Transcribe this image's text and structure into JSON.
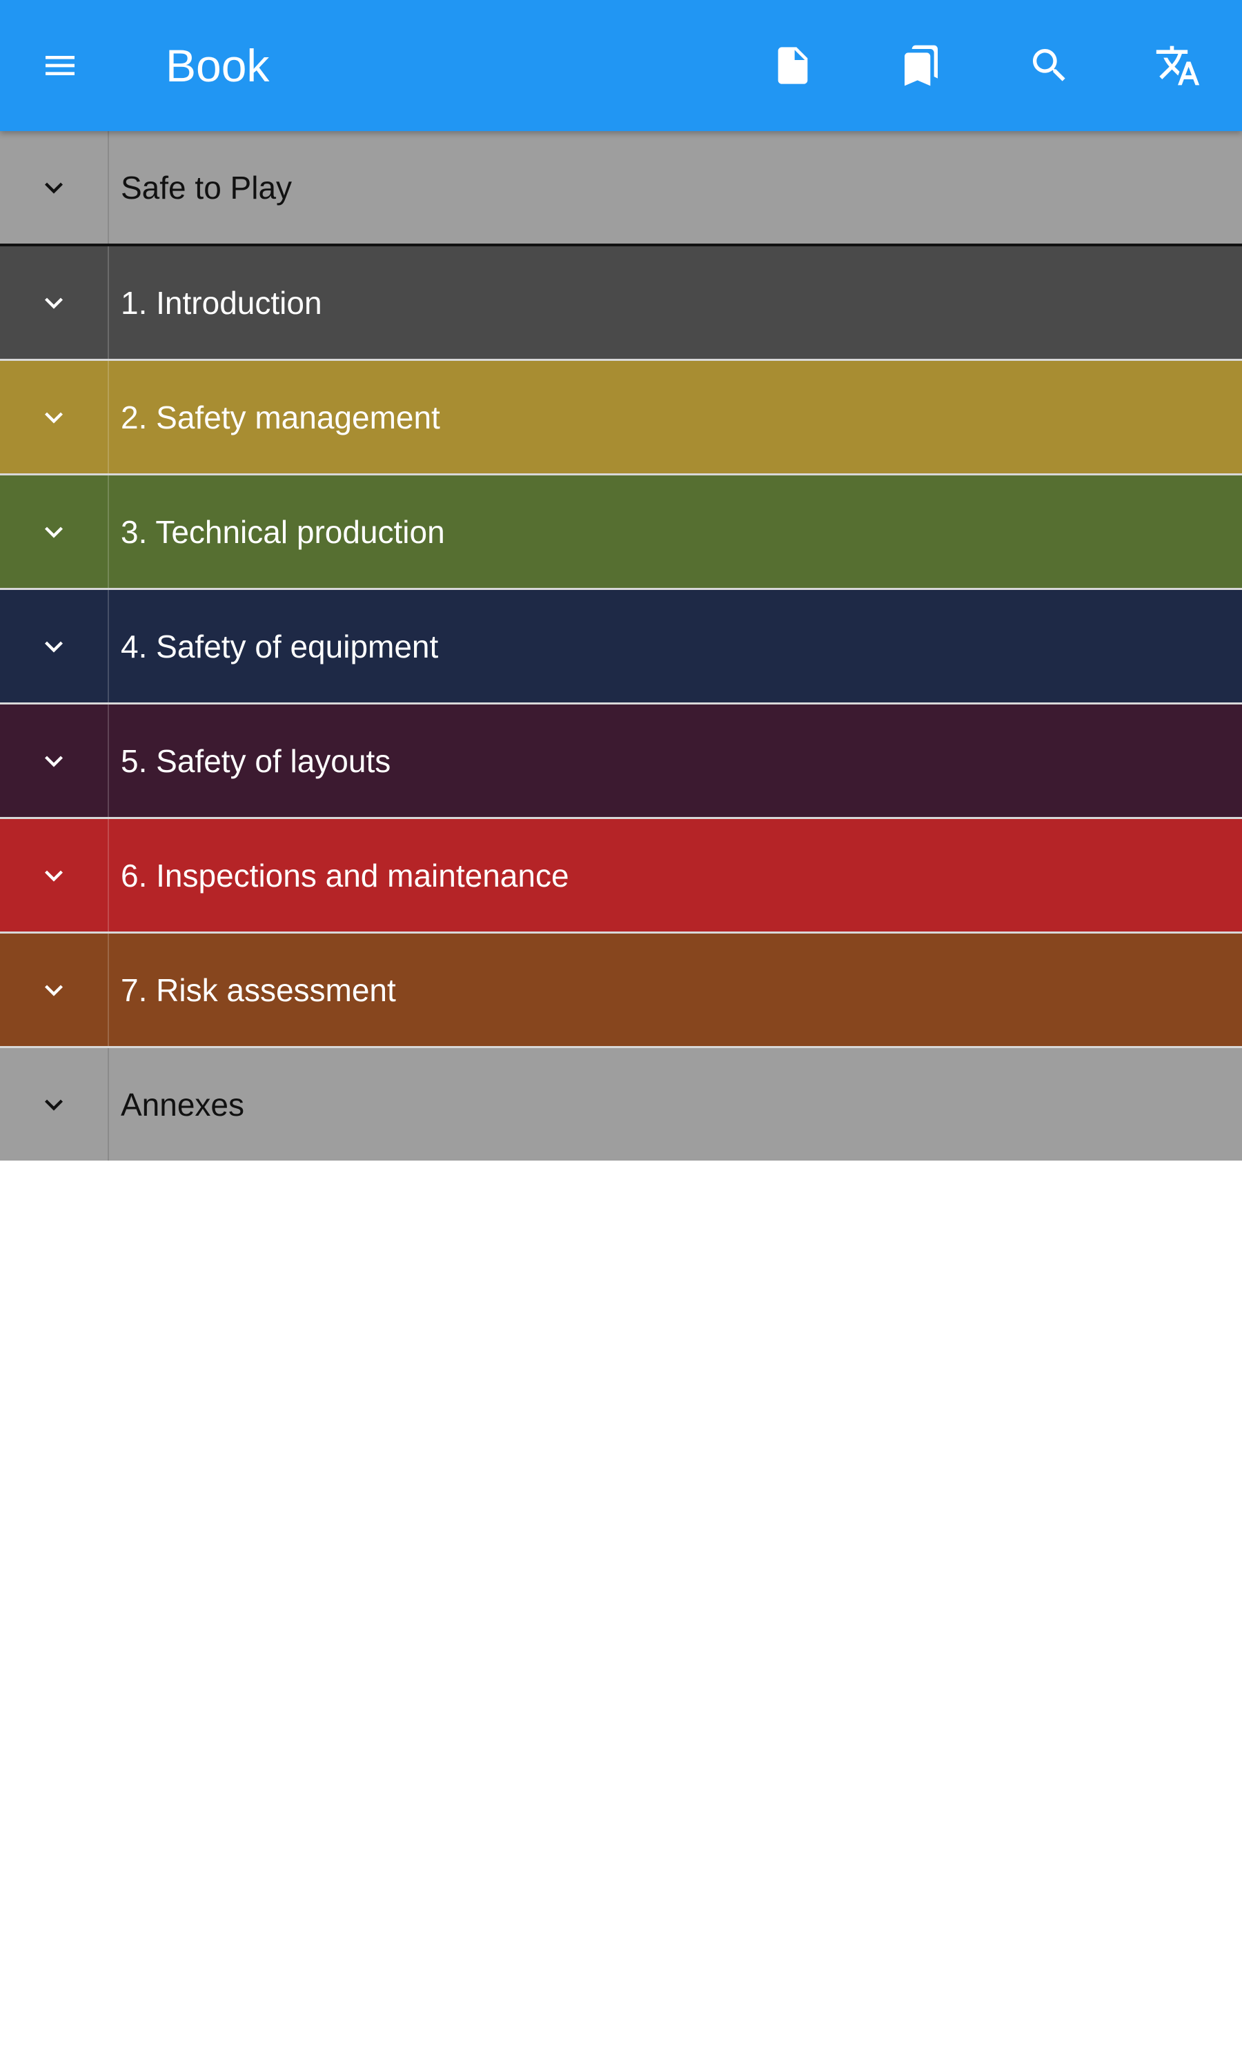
{
  "appbar": {
    "title": "Book",
    "background": "#2196f3",
    "actions": [
      {
        "name": "document-icon"
      },
      {
        "name": "bookmarks-icon"
      },
      {
        "name": "search-icon"
      },
      {
        "name": "translate-icon"
      }
    ]
  },
  "chapters": [
    {
      "label": "Safe to Play",
      "bg": "#9e9e9e",
      "fg": "#111111"
    },
    {
      "label": "1. Introduction",
      "bg": "#4a4a4a",
      "fg": "#ffffff"
    },
    {
      "label": "2. Safety management",
      "bg": "#a88d32",
      "fg": "#ffffff"
    },
    {
      "label": "3. Technical production",
      "bg": "#566f31",
      "fg": "#ffffff"
    },
    {
      "label": "4. Safety of equipment",
      "bg": "#1e2946",
      "fg": "#ffffff"
    },
    {
      "label": "5. Safety of layouts",
      "bg": "#3c1a30",
      "fg": "#ffffff"
    },
    {
      "label": "6. Inspections and maintenance",
      "bg": "#b52427",
      "fg": "#ffffff"
    },
    {
      "label": "7. Risk assessment",
      "bg": "#87461e",
      "fg": "#ffffff"
    },
    {
      "label": "Annexes",
      "bg": "#9e9e9e",
      "fg": "#111111"
    }
  ]
}
